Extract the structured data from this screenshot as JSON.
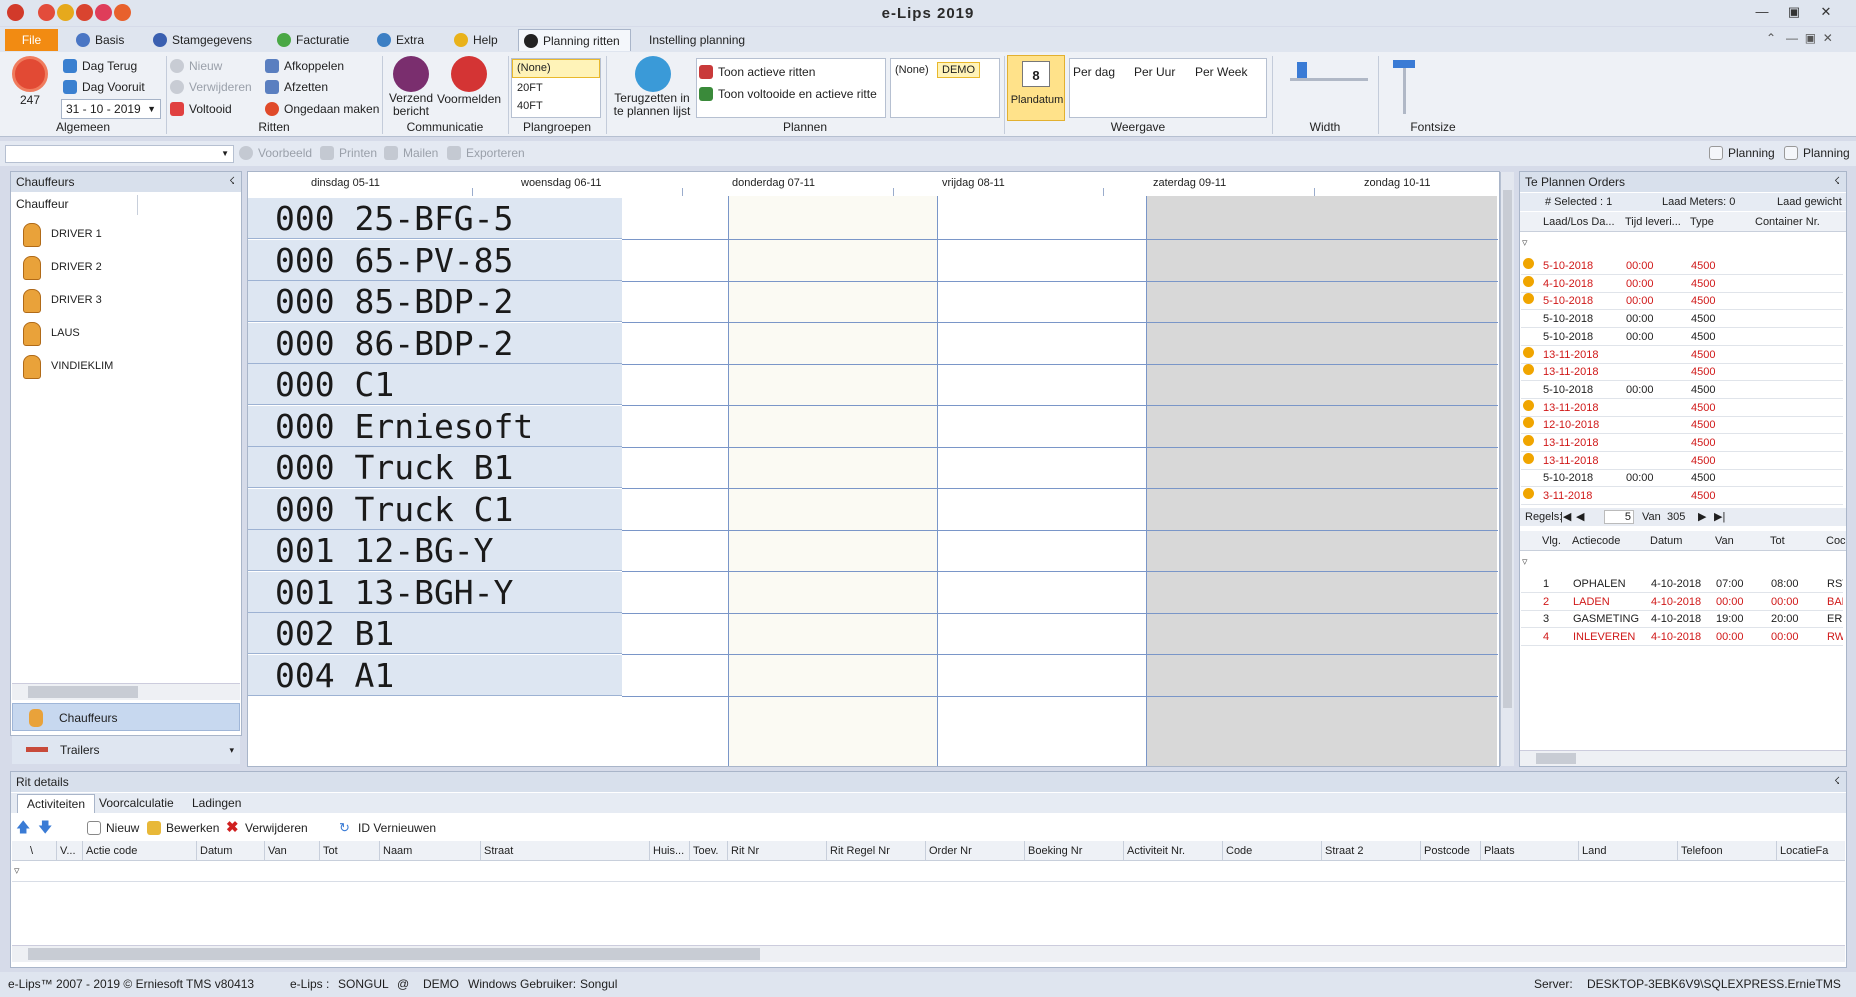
{
  "window": {
    "title": "e-Lips 2019"
  },
  "menu": {
    "file": "File",
    "tabs": [
      "Basis",
      "Stamgegevens",
      "Facturatie",
      "Extra",
      "Help",
      "Planning ritten",
      "Instelling planning"
    ]
  },
  "ribbon": {
    "algemeen": {
      "count": "247",
      "dag_terug": "Dag Terug",
      "dag_vooruit": "Dag Vooruit",
      "date": "31 - 10 - 2019",
      "label": "Algemeen"
    },
    "ritten": {
      "nieuw": "Nieuw",
      "verwijderen": "Verwijderen",
      "voltooid": "Voltooid",
      "afkoppelen": "Afkoppelen",
      "afzetten": "Afzetten",
      "ongedaan": "Ongedaan maken",
      "label": "Ritten"
    },
    "communicatie": {
      "verzend1": "Verzend",
      "verzend2": "bericht",
      "voormelden": "Voormelden",
      "label": "Communicatie"
    },
    "plangroepen": {
      "items": [
        "(None)",
        "20FT",
        "40FT"
      ],
      "label": "Plangroepen"
    },
    "plannen": {
      "terug1": "Terugzetten in",
      "terug2": "te plannen lijst",
      "actieve": "Toon actieve ritten",
      "voltooide": "Toon voltooide en actieve ritte",
      "none": "(None)",
      "demo": "DEMO",
      "label": "Plannen"
    },
    "weergave": {
      "plandatum_num": "8",
      "plandatum": "Plandatum",
      "per_dag": "Per dag",
      "per_uur": "Per Uur",
      "per_week": "Per Week",
      "label": "Weergave"
    },
    "width_label": "Width",
    "fontsize_label": "Fontsize"
  },
  "toolbar2": {
    "voorbeeld": "Voorbeeld",
    "printen": "Printen",
    "mailen": "Mailen",
    "exporteren": "Exporteren",
    "planning1": "Planning",
    "planning2": "Planning"
  },
  "chauffeurs": {
    "title": "Chauffeurs",
    "col": "Chauffeur",
    "items": [
      "DRIVER 1",
      "DRIVER 2",
      "DRIVER 3",
      "LAUS",
      "VINDIEKLIM"
    ],
    "nav_chauffeurs": "Chauffeurs",
    "nav_trailers": "Trailers"
  },
  "planning": {
    "days": [
      "dinsdag 05-11",
      "woensdag 06-11",
      "donderdag 07-11",
      "vrijdag 08-11",
      "zaterdag 09-11",
      "zondag 10-11"
    ],
    "resources": [
      "000  25-BFG-5",
      "000  65-PV-85",
      "000  85-BDP-2",
      "000  86-BDP-2",
      "000  C1",
      "000  Erniesoft",
      "000  Truck B1",
      "000  Truck C1",
      "001  12-BG-Y",
      "001  13-BGH-Y",
      "002  B1",
      "004  A1"
    ]
  },
  "te_plannen": {
    "title": "Te Plannen Orders",
    "selected": "# Selected : 1",
    "laad_meters": "Laad Meters: 0",
    "laad_gewicht": "Laad gewicht",
    "cols": [
      "Laad/Los  Da...",
      "Tijd leveri...",
      "Type",
      "Container Nr."
    ],
    "rows": [
      {
        "date": "5-10-2018",
        "time": "00:00",
        "type": "4500",
        "red": true,
        "warn": true
      },
      {
        "date": "4-10-2018",
        "time": "00:00",
        "type": "4500",
        "red": true,
        "warn": true
      },
      {
        "date": "5-10-2018",
        "time": "00:00",
        "type": "4500",
        "red": true,
        "warn": true
      },
      {
        "date": "5-10-2018",
        "time": "00:00",
        "type": "4500",
        "red": false,
        "warn": false
      },
      {
        "date": "5-10-2018",
        "time": "00:00",
        "type": "4500",
        "red": false,
        "warn": false
      },
      {
        "date": "13-11-2018",
        "time": "",
        "type": "4500",
        "red": true,
        "warn": true
      },
      {
        "date": "13-11-2018",
        "time": "",
        "type": "4500",
        "red": true,
        "warn": true
      },
      {
        "date": "5-10-2018",
        "time": "00:00",
        "type": "4500",
        "red": false,
        "warn": false
      },
      {
        "date": "13-11-2018",
        "time": "",
        "type": "4500",
        "red": true,
        "warn": true
      },
      {
        "date": "12-10-2018",
        "time": "",
        "type": "4500",
        "red": true,
        "warn": true
      },
      {
        "date": "13-11-2018",
        "time": "",
        "type": "4500",
        "red": true,
        "warn": true
      },
      {
        "date": "13-11-2018",
        "time": "",
        "type": "4500",
        "red": true,
        "warn": true
      },
      {
        "date": "5-10-2018",
        "time": "00:00",
        "type": "4500",
        "red": false,
        "warn": false
      },
      {
        "date": "3-11-2018",
        "time": "",
        "type": "4500",
        "red": true,
        "warn": true
      }
    ],
    "regels": "Regels:",
    "page": "5",
    "van": "Van",
    "total": "305",
    "act_cols": [
      "Vlg.",
      "Actiecode",
      "Datum",
      "Van",
      "Tot",
      "Coc"
    ],
    "activities": [
      {
        "vlg": "1",
        "code": "OPHALEN",
        "datum": "4-10-2018",
        "van": "07:00",
        "tot": "08:00",
        "coc": "RST",
        "red": false
      },
      {
        "vlg": "2",
        "code": "LADEN",
        "datum": "4-10-2018",
        "van": "00:00",
        "tot": "00:00",
        "coc": "BAK",
        "red": true
      },
      {
        "vlg": "3",
        "code": "GASMETING",
        "datum": "4-10-2018",
        "van": "19:00",
        "tot": "20:00",
        "coc": "ERN",
        "red": false
      },
      {
        "vlg": "4",
        "code": "INLEVEREN",
        "datum": "4-10-2018",
        "van": "00:00",
        "tot": "00:00",
        "coc": "RW",
        "red": true
      }
    ]
  },
  "rit_details": {
    "title": "Rit details",
    "tabs": [
      "Activiteiten",
      "Voorcalculatie",
      "Ladingen"
    ],
    "nieuw": "Nieuw",
    "bewerken": "Bewerken",
    "verwijderen": "Verwijderen",
    "id_vernieuwen": "ID Vernieuwen",
    "cols": [
      "\\",
      "V...",
      "Actie code",
      "Datum",
      "Van",
      "Tot",
      "Naam",
      "Straat",
      "Huis...",
      "Toev.",
      "Rit Nr",
      "Rit Regel Nr",
      "Order Nr",
      "Boeking Nr",
      "Activiteit Nr.",
      "Code",
      "Straat 2",
      "Postcode",
      "Plaats",
      "Land",
      "Telefoon",
      "LocatieFa"
    ]
  },
  "status": {
    "copyright": "e-Lips™ 2007 - 2019 © Erniesoft TMS v80413",
    "elips": "e-Lips :",
    "user": "SONGUL",
    "at": "@",
    "demo": "DEMO",
    "win_user_label": "Windows Gebruiker:",
    "win_user": "Songul",
    "server_label": "Server:",
    "server": "DESKTOP-3EBK6V9\\SQLEXPRESS.ErnieTMS"
  },
  "colors": {
    "accent": "#f28b12",
    "grid": "#7a96c8",
    "weekend": "#d8d8d8",
    "resource_bg": "#dde6f2",
    "error_red": "#d01818"
  }
}
